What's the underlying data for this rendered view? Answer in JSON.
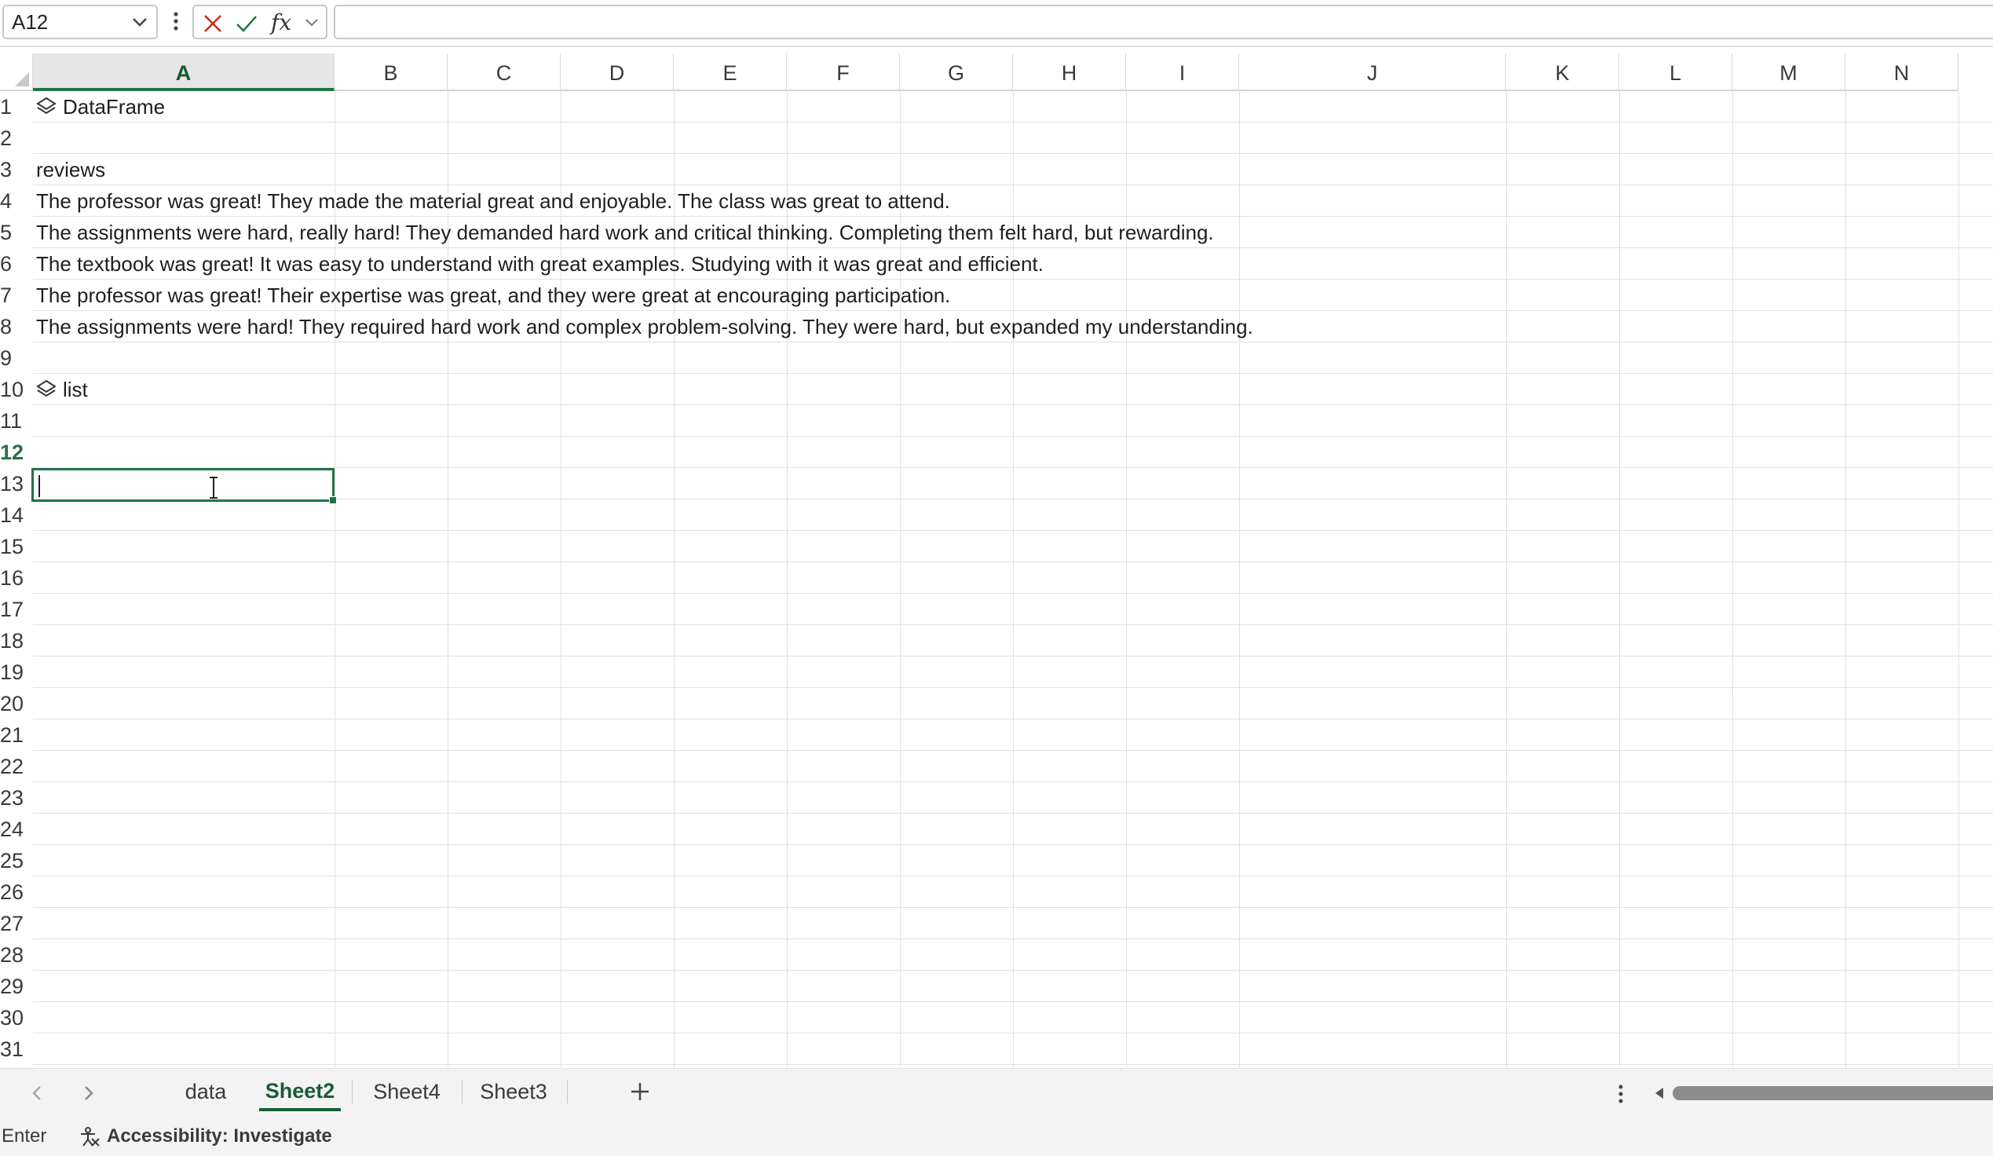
{
  "formula_bar": {
    "name_box": "A12",
    "formula_value": ""
  },
  "columns": [
    "A",
    "B",
    "C",
    "D",
    "E",
    "F",
    "G",
    "H",
    "I",
    "J",
    "K",
    "L",
    "M",
    "N"
  ],
  "rows": [
    "1",
    "2",
    "3",
    "4",
    "5",
    "6",
    "7",
    "8",
    "9",
    "10",
    "11",
    "12",
    "13",
    "14",
    "15",
    "16",
    "17",
    "18",
    "19",
    "20",
    "21",
    "22",
    "23",
    "24",
    "25",
    "26",
    "27",
    "28",
    "29",
    "30",
    "31"
  ],
  "cells": {
    "r1": "DataFrame",
    "r3": "reviews",
    "r4": "The professor was great! They made the material great and enjoyable. The class was great to attend.",
    "r5": "The assignments were hard, really hard! They demanded hard work and critical thinking. Completing them felt hard, but rewarding.",
    "r6": "The textbook was great! It was easy to understand with great examples. Studying with it was great and efficient.",
    "r7": "The professor was great! Their expertise was great, and they were great at encouraging participation.",
    "r8": "The assignments were hard! They required hard work and complex problem-solving. They were hard, but expanded my understanding.",
    "r10": "list"
  },
  "sheet_tabs": [
    {
      "label": "data",
      "active": false
    },
    {
      "label": "Sheet2",
      "active": true
    },
    {
      "label": "Sheet4",
      "active": false
    },
    {
      "label": "Sheet3",
      "active": false
    }
  ],
  "status_bar": {
    "mode": "Enter",
    "accessibility": "Accessibility: Investigate"
  },
  "icons": {
    "python_object": "python-object-icon",
    "cancel": "cancel-x-icon",
    "enter": "check-icon",
    "function": "fx-icon"
  },
  "colors": {
    "accent": "#217346",
    "cancel_red": "#c42b1c"
  }
}
